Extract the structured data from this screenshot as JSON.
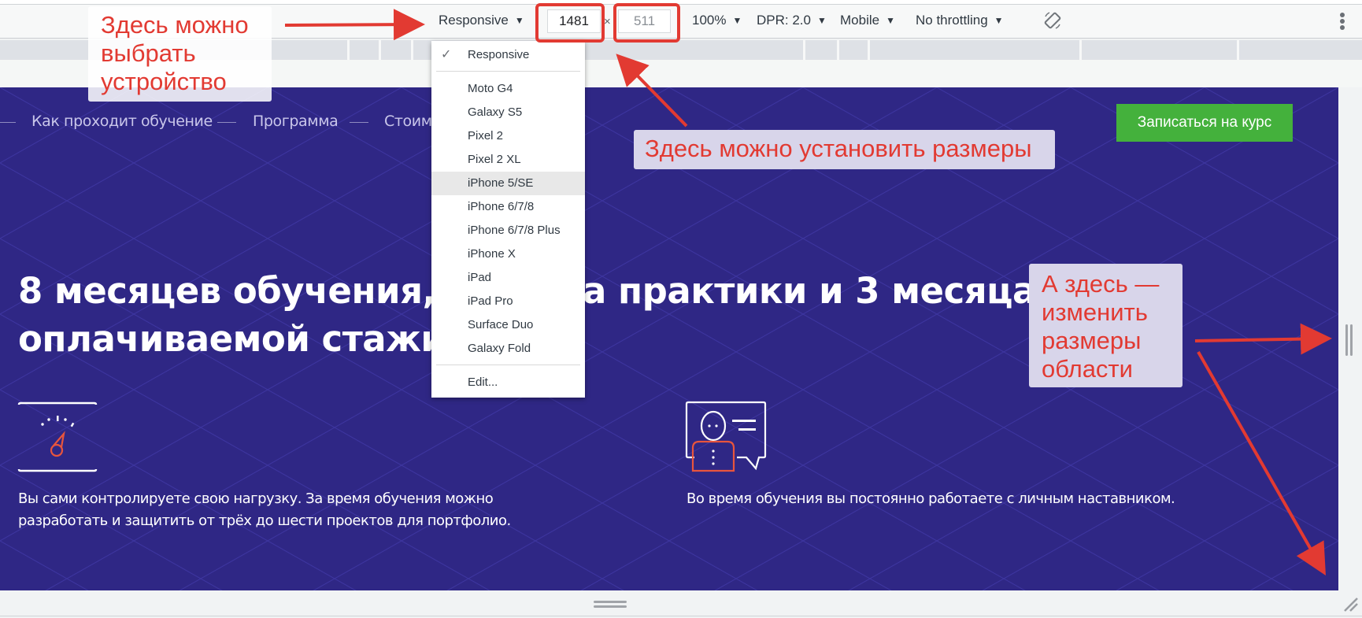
{
  "toolbar": {
    "device_select": "Responsive",
    "width_value": "1481",
    "height_value": "511",
    "times": "×",
    "zoom": "100%",
    "dpr": "DPR: 2.0",
    "mode": "Mobile",
    "throttling": "No throttling",
    "rotate_icon": "rotate-icon",
    "more_icon": "kebab-icon",
    "dropdown_triangle": "▼"
  },
  "device_menu": {
    "selected": "Responsive",
    "check_glyph": "✓",
    "highlighted": "iPhone 5/SE",
    "items": [
      "Moto G4",
      "Galaxy S5",
      "Pixel 2",
      "Pixel 2 XL",
      "iPhone 5/SE",
      "iPhone 6/7/8",
      "iPhone 6/7/8 Plus",
      "iPhone X",
      "iPad",
      "iPad Pro",
      "Surface Duo",
      "Galaxy Fold"
    ],
    "edit": "Edit..."
  },
  "page": {
    "nav": [
      "Как проходит обучение",
      "Программа",
      "Стоим"
    ],
    "cta": "Записаться на курс",
    "headline": {
      "line1_left": "8 месяцев обучения,",
      "line1_right": "а практики и 3 месяца",
      "line2_left": "оплачиваемой стажи"
    },
    "features": [
      {
        "icon": "gauge-icon",
        "text_line1": "Вы сами контролируете свою нагрузку. За время обучения можно",
        "text_line2": "разработать и защитить от трёх до шести проектов для портфолио."
      },
      {
        "icon": "mentor-chat-icon",
        "text_line1": "Во время обучения вы постоянно работаете с личным наставником."
      }
    ],
    "colors": {
      "background": "#2f2785",
      "cta": "#44b13c",
      "accent_icon": "#e8553d"
    }
  },
  "annotations": {
    "device": [
      "Здесь можно",
      "выбрать",
      "устройство"
    ],
    "dimensions": "Здесь можно установить размеры",
    "resize": [
      "А здесь —",
      "изменить",
      "размеры",
      "области"
    ],
    "color": "#e23a32"
  }
}
